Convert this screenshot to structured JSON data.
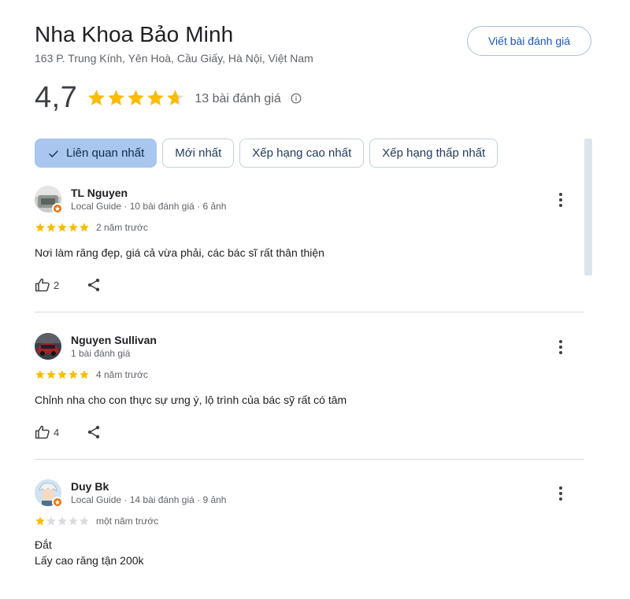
{
  "place": {
    "name": "Nha Khoa Bảo Minh",
    "address": "163 P. Trung Kính, Yên Hoà, Cầu Giấy, Hà Nội, Việt Nam",
    "write_review_label": "Viết bài đánh giá",
    "rating": "4,7",
    "rating_value": 4.7,
    "review_count_label": "13 bài đánh giá"
  },
  "colors": {
    "star": "#fbbc04",
    "star_empty": "#dadce0",
    "accent": "#1a57b8",
    "chip_active": "#a9c7ee"
  },
  "sort_chips": [
    {
      "label": "Liên quan nhất",
      "active": true
    },
    {
      "label": "Mới nhất",
      "active": false
    },
    {
      "label": "Xếp hạng cao nhất",
      "active": false
    },
    {
      "label": "Xếp hạng thấp nhất",
      "active": false
    }
  ],
  "reviews": [
    {
      "name": "TL Nguyen",
      "meta": "Local Guide · 10 bài đánh giá · 6 ảnh",
      "stars": 5,
      "time": "2 năm trước",
      "text": "Nơi làm răng đẹp, giá cả vừa phải, các bác sĩ rất thân thiện",
      "likes": "2",
      "local_guide": true
    },
    {
      "name": "Nguyen Sullivan",
      "meta": "1 bài đánh giá",
      "stars": 5,
      "time": "4 năm trước",
      "text": "Chỉnh nha cho con thực sự ưng ý, lộ trình của bác sỹ rất có tâm",
      "likes": "4",
      "local_guide": false
    },
    {
      "name": "Duy Bk",
      "meta": "Local Guide · 14 bài đánh giá · 9 ảnh",
      "stars": 1,
      "time": "một năm trước",
      "text_lines": [
        "Đắt",
        "Lấy cao răng tận 200k"
      ],
      "local_guide": true
    }
  ]
}
